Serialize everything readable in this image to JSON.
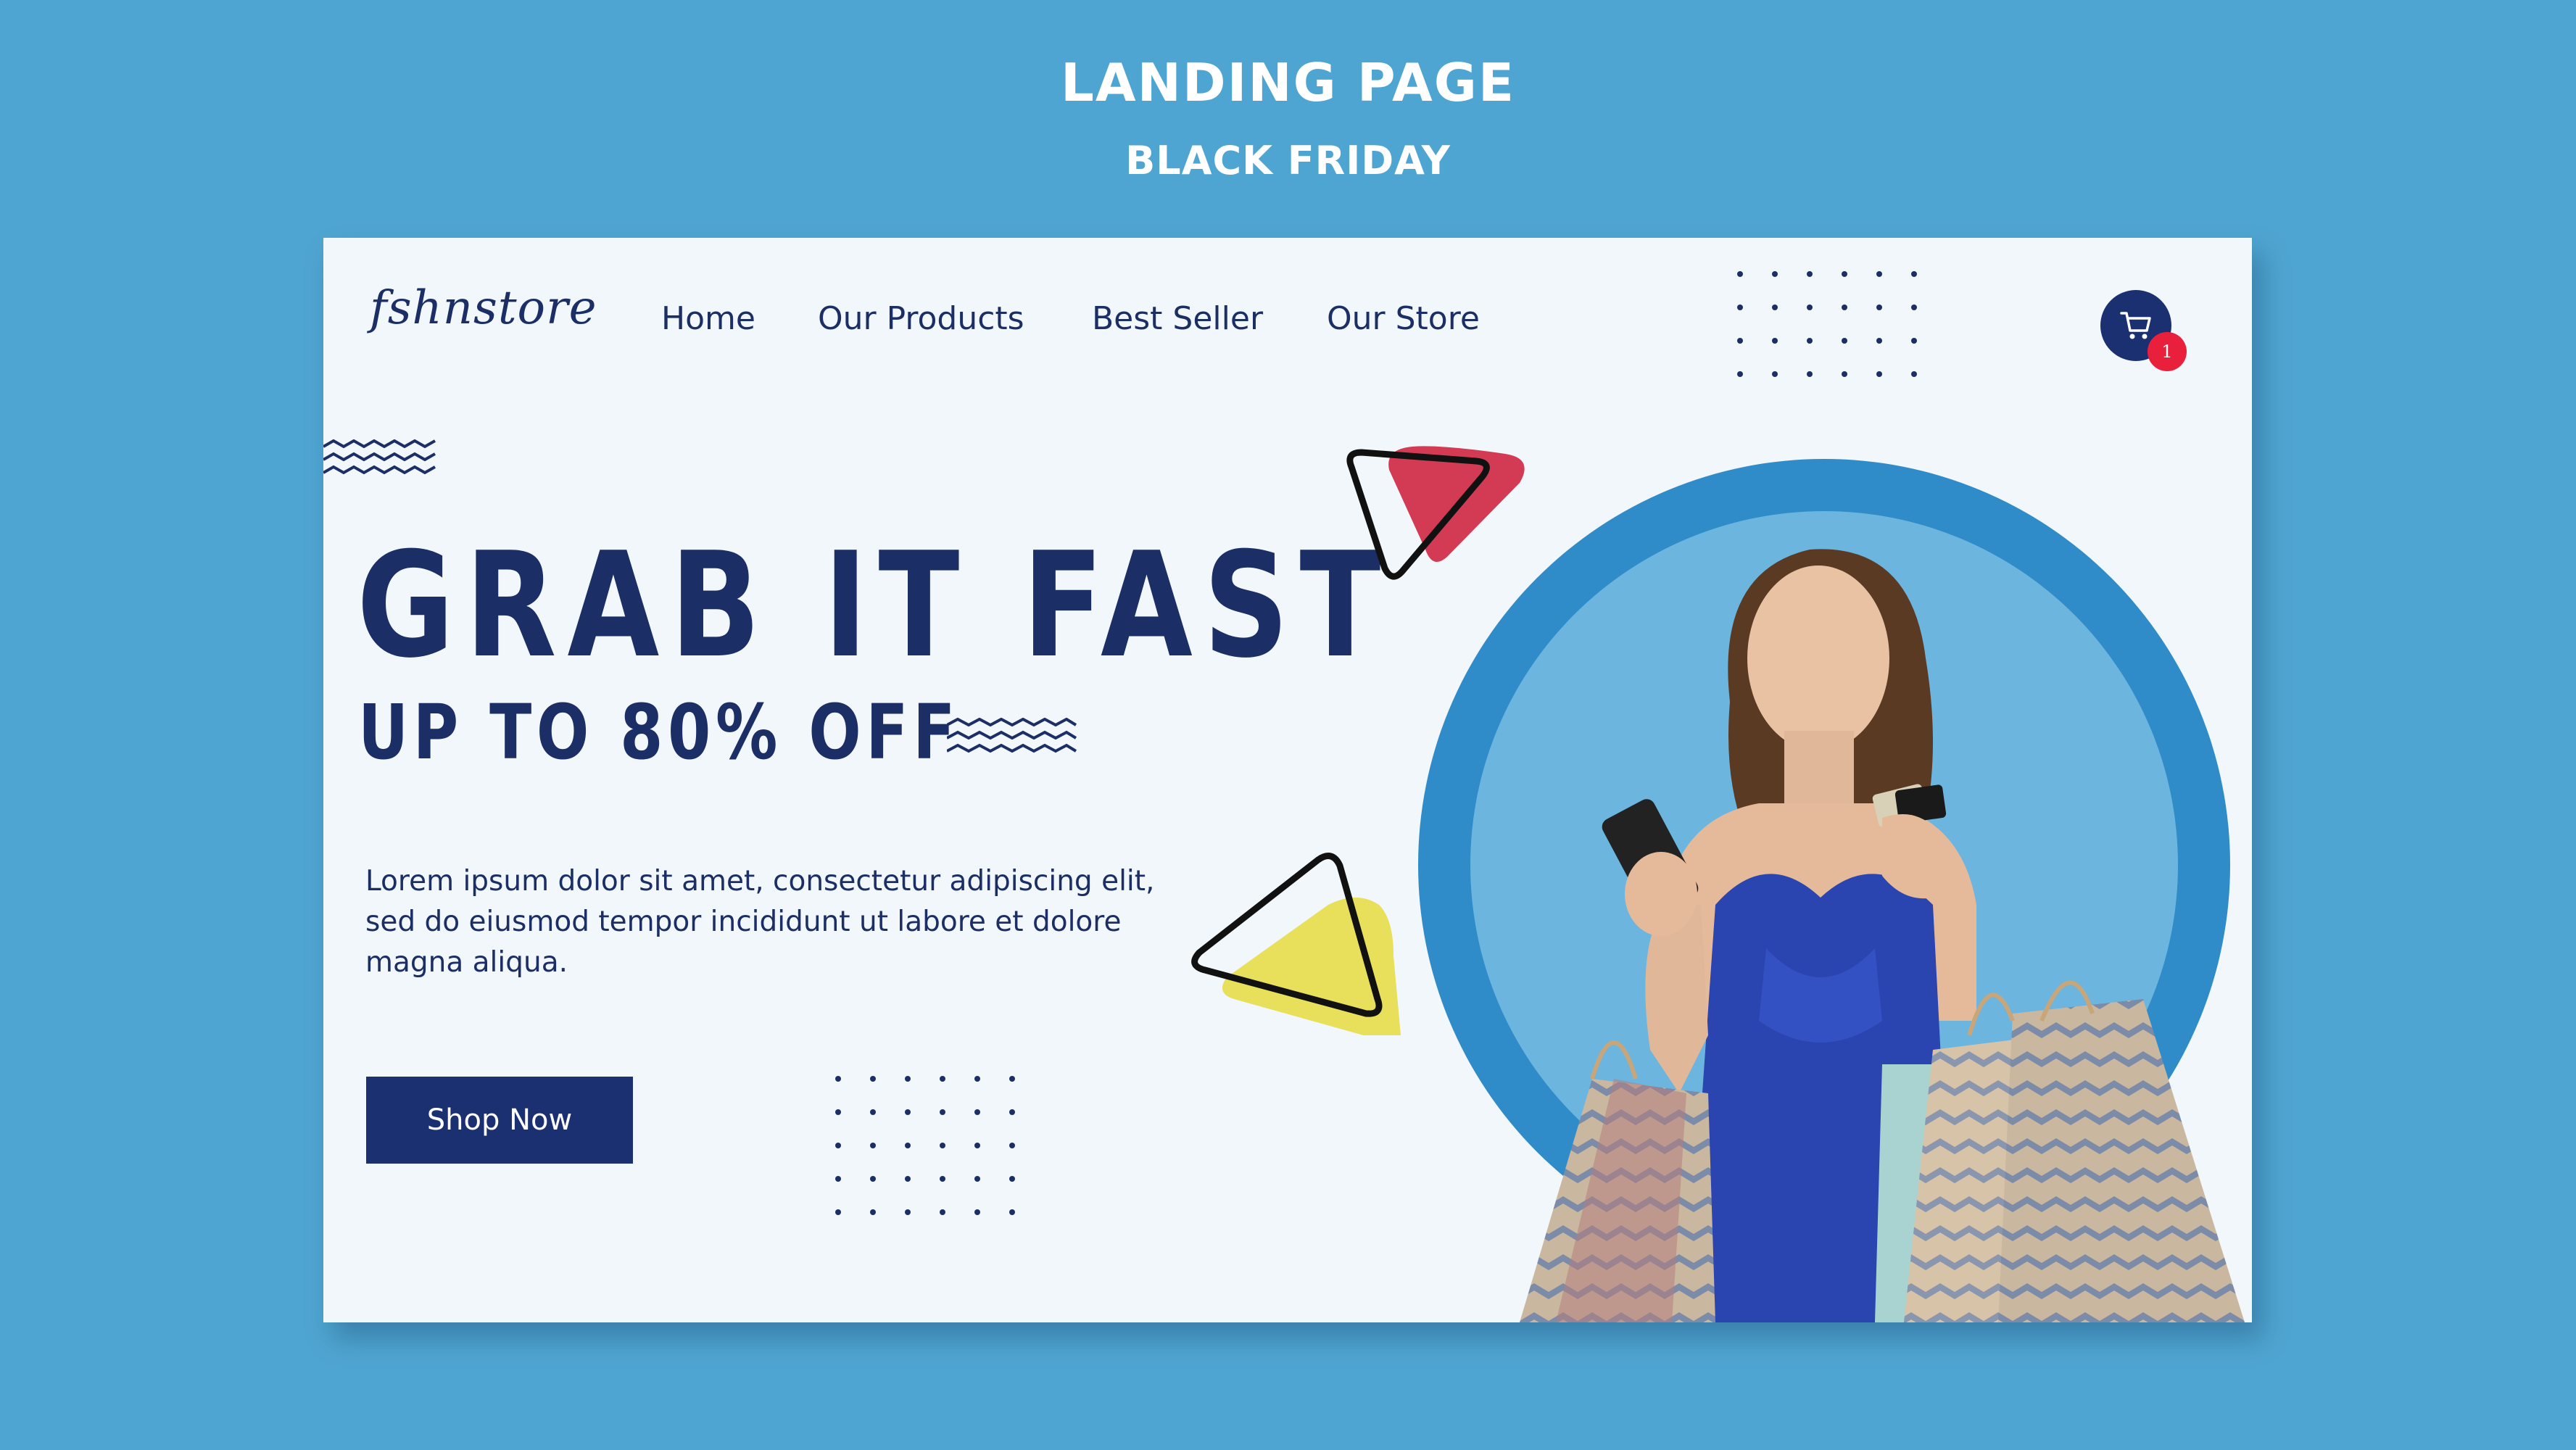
{
  "header": {
    "title": "LANDING PAGE",
    "subtitle": "BLACK FRIDAY"
  },
  "brand": {
    "logo_text": "fshnstore"
  },
  "nav": {
    "items": [
      {
        "label": "Home"
      },
      {
        "label": "Our Products"
      },
      {
        "label": "Best Seller"
      },
      {
        "label": "Our Store"
      }
    ]
  },
  "cart": {
    "icon": "shopping-cart-icon",
    "badge_count": "1"
  },
  "hero": {
    "headline": "GRAB IT FAST",
    "subheadline": "UP TO 80% OFF",
    "body": "Lorem ipsum dolor sit amet, consectetur adipiscing elit, sed do eiusmod tempor incididunt ut labore et dolore magna aliqua.",
    "cta_label": "Shop Now"
  },
  "colors": {
    "background": "#4FA5D1",
    "card": "#F1F7FB",
    "navy": "#1B2E66",
    "accent_red": "#D23B53",
    "accent_yellow": "#E8DF5A",
    "badge_red": "#E8203C",
    "ring_blue": "#2F8CC9",
    "circle_blue": "#6BB5DF",
    "dress_blue": "#2A45B0"
  }
}
